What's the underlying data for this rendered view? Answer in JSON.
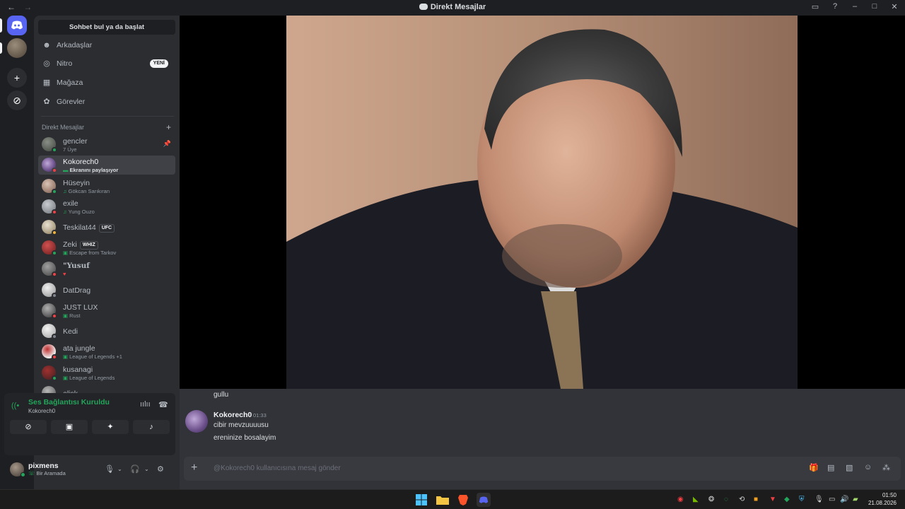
{
  "titlebar": {
    "title": "Direkt Mesajlar",
    "back": "←",
    "forward": "→"
  },
  "sidebar": {
    "search_label": "Sohbet bul ya da başlat",
    "nav": [
      {
        "label": "Arkadaşlar",
        "icon": "friends-icon",
        "glyph": "☻"
      },
      {
        "label": "Nitro",
        "icon": "nitro-icon",
        "glyph": "◎"
      },
      {
        "label": "Mağaza",
        "icon": "shop-icon",
        "glyph": "▦"
      },
      {
        "label": "Görevler",
        "icon": "quests-icon",
        "glyph": "✿"
      }
    ],
    "nitro_badge": "YENİ",
    "dm_header": "Direkt Mesajlar",
    "dms": [
      {
        "name": "gencler",
        "sub": "7 Üye"
      },
      {
        "name": "Kokorech0",
        "sub": "Ekranını paylaşıyor"
      },
      {
        "name": "Hüseyin",
        "sub": "Gökcan Sarıkıran"
      },
      {
        "name": "exile",
        "sub": "Yung Ouzo"
      },
      {
        "name": "Teskilat44",
        "tag": "UFC"
      },
      {
        "name": "Zeki",
        "tag": "WHIZ",
        "sub": "Escape from Tarkov"
      },
      {
        "name": "\"Yusuf",
        "sub": ""
      },
      {
        "name": "DatDrag"
      },
      {
        "name": "JUST LUX",
        "sub": "Rust"
      },
      {
        "name": "Kedi"
      },
      {
        "name": "ata jungle",
        "sub": "League of Legends +1"
      },
      {
        "name": "kusanagi",
        "sub": "League of Legends"
      },
      {
        "name": "elisk"
      }
    ]
  },
  "voice": {
    "title": "Ses Bağlantısı Kuruldu",
    "channel": "Kokorech0"
  },
  "user": {
    "name": "pixmens",
    "status": "Bir Aramada"
  },
  "messages": {
    "prev_text": "gullu",
    "author": "Kokorech0",
    "time": "01:33",
    "lines": [
      "cibir mevzuuuusu",
      "ereninize bosalayim"
    ]
  },
  "composer": {
    "placeholder": "@Kokorech0 kullanıcısına mesaj gönder"
  },
  "clock": {
    "time": "01:50",
    "date": "21.08.2026"
  }
}
